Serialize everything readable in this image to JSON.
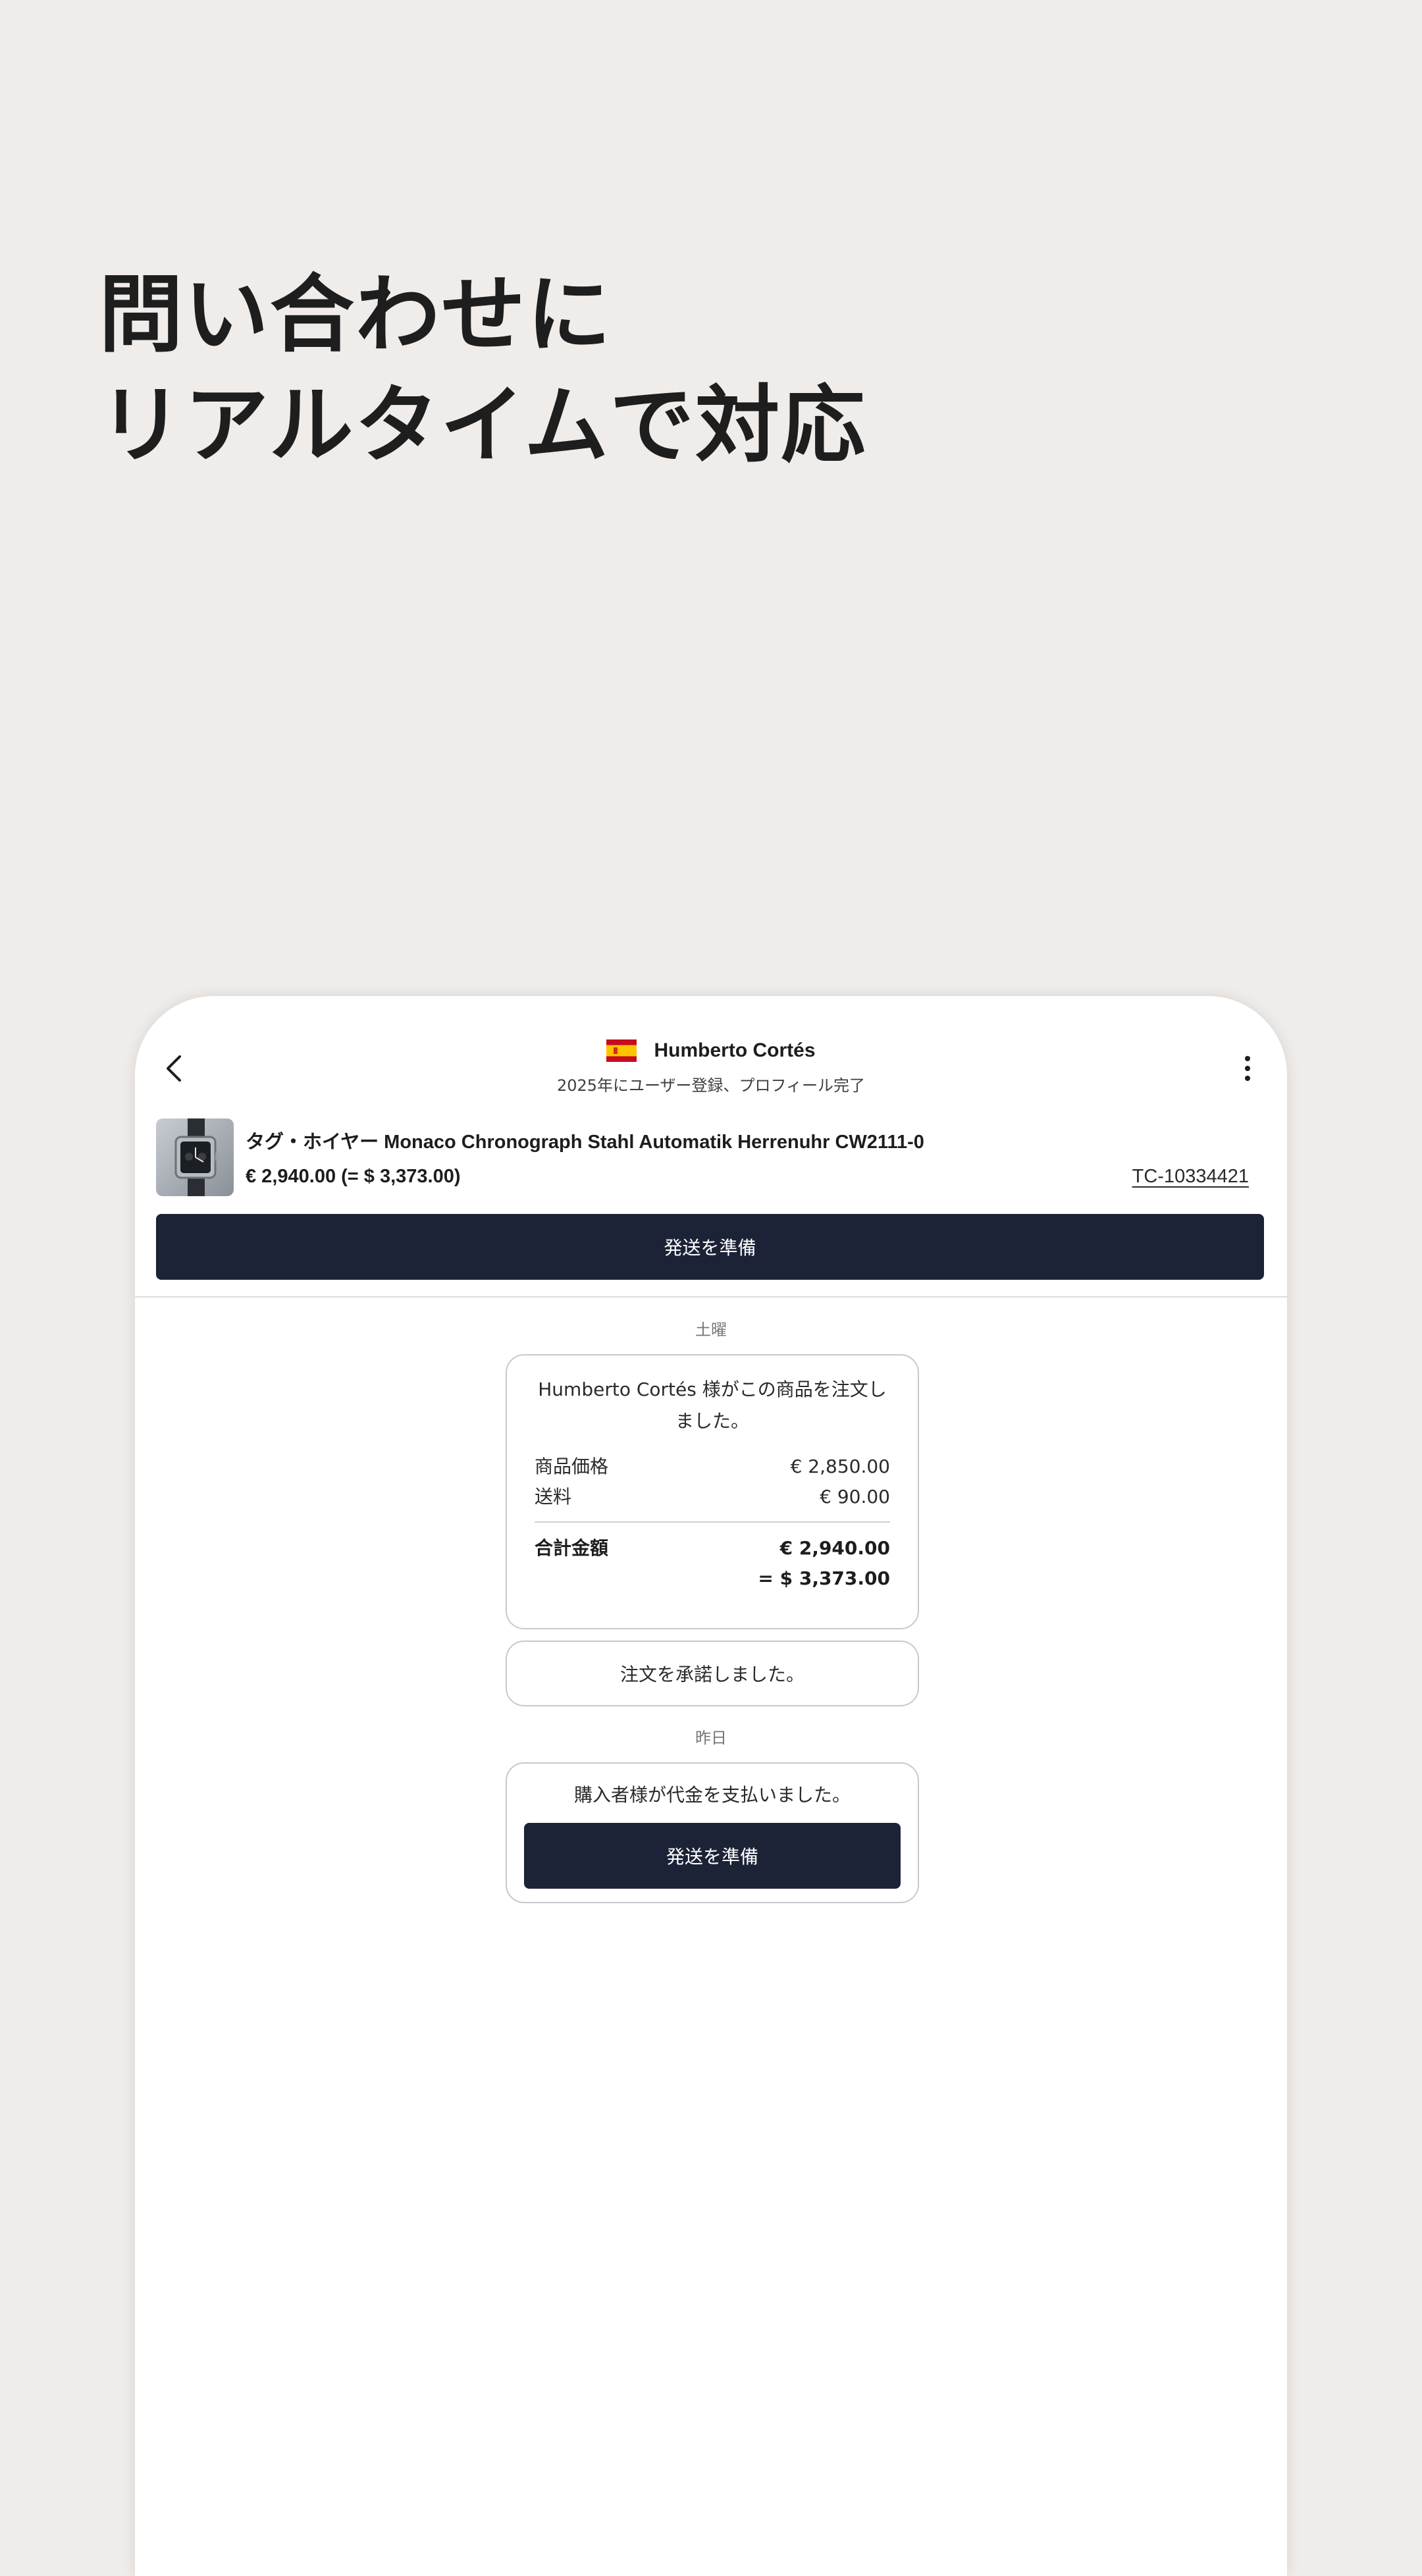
{
  "headline": {
    "line1": "問い合わせに",
    "line2": "リアルタイムで対応"
  },
  "header": {
    "user_name": "Humberto Cortés",
    "user_flag": "spain-flag-icon",
    "user_subtitle": "2025年にユーザー登録、プロフィール完了"
  },
  "product": {
    "title": "タグ・ホイヤー Monaco Chronograph Stahl Automatik Herrenuhr CW2111-0",
    "price": "€ 2,940.00 (= $ 3,373.00)",
    "order_id": "TC-10334421",
    "thumb_icon": "watch-icon"
  },
  "actions": {
    "prepare_shipping": "発送を準備"
  },
  "chat": {
    "day1": "土曜",
    "order_message": "Humberto Cortés 様がこの商品を注文しました。",
    "item_price_label": "商品価格",
    "item_price_value": "€ 2,850.00",
    "shipping_label": "送料",
    "shipping_value": "€ 90.00",
    "total_label": "合計金額",
    "total_value": "€ 2,940.00",
    "total_usd": "= $ 3,373.00",
    "accepted_message": "注文を承諾しました。",
    "day2": "昨日",
    "paid_message": "購入者様が代金を支払いました。",
    "paid_button": "発送を準備"
  },
  "colors": {
    "background": "#efecea",
    "primary_button": "#1c2337",
    "flag_red": "#c60b1e",
    "flag_yellow": "#ffc400"
  }
}
